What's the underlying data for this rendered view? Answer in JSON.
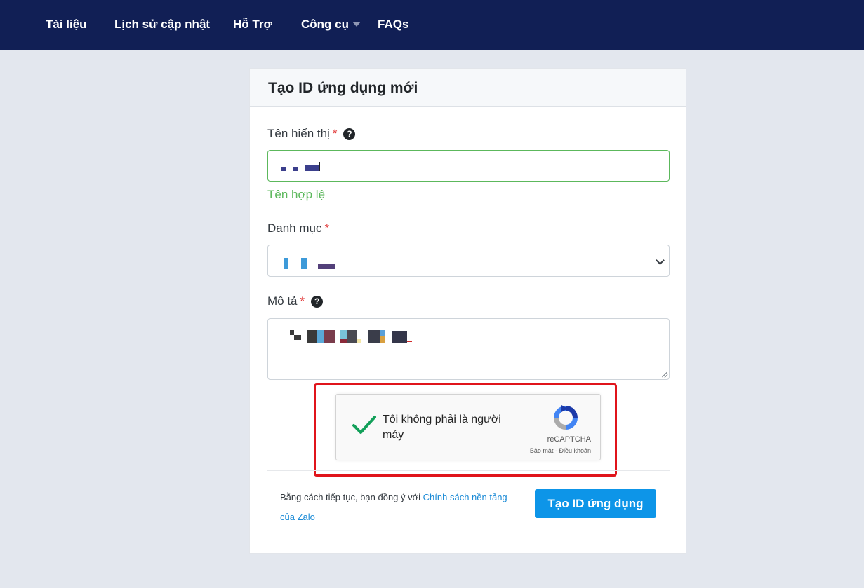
{
  "nav": {
    "items": [
      {
        "label": "Tài liệu"
      },
      {
        "label": "Lịch sử cập nhật"
      },
      {
        "label": "Hỗ Trợ"
      },
      {
        "label": "Công cụ"
      },
      {
        "label": "FAQs"
      }
    ]
  },
  "form": {
    "title": "Tạo ID ứng dụng mới",
    "display_name": {
      "label": "Tên hiển thị",
      "required_mark": "*",
      "valid_message": "Tên hợp lệ"
    },
    "category": {
      "label": "Danh mục",
      "required_mark": "*"
    },
    "description": {
      "label": "Mô tả",
      "required_mark": "*"
    },
    "help_icon_glyph": "?",
    "recaptcha": {
      "label": "Tôi không phải là người máy",
      "brand": "reCAPTCHA",
      "privacy_link": "Bảo mật",
      "separator": " - ",
      "terms_link": "Điều khoản"
    },
    "terms_prefix": "Bằng cách tiếp tục, bạn đồng ý với",
    "terms_link": "Chính sách nền tảng của Zalo",
    "submit_label": "Tạo ID ứng dụng"
  },
  "colors": {
    "nav_bg": "#111f55",
    "accent": "#0d95e8",
    "valid": "#5cb85c",
    "highlight": "#e0141b"
  }
}
